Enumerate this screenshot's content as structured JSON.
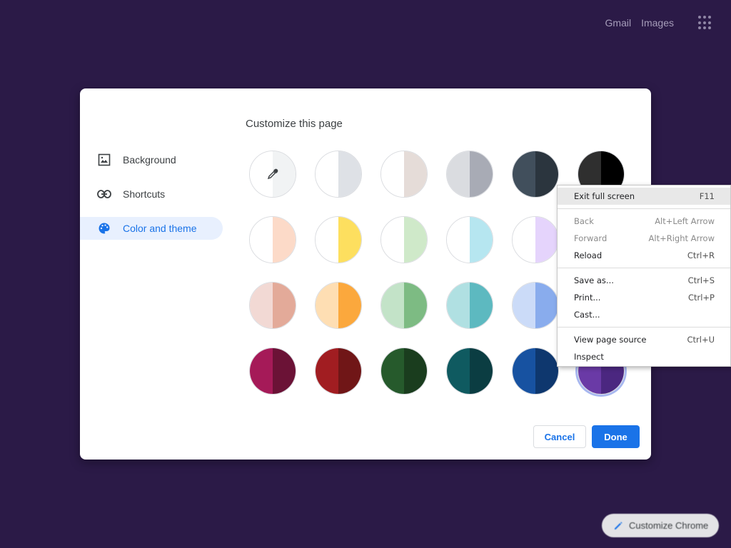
{
  "topbar": {
    "gmail": "Gmail",
    "images": "Images"
  },
  "dialog": {
    "title": "Customize this page",
    "nav": [
      {
        "label": "Background",
        "icon": "image-icon"
      },
      {
        "label": "Shortcuts",
        "icon": "link-icon"
      },
      {
        "label": "Color and theme",
        "icon": "palette-icon",
        "active": true
      }
    ],
    "swatches": [
      {
        "left": "#ffffff",
        "right": "#f1f3f4",
        "type": "custom"
      },
      {
        "left": "#ffffff",
        "right": "#dee1e6"
      },
      {
        "left": "#ffffff",
        "right": "#e5dcd8"
      },
      {
        "left": "#dadce0",
        "right": "#a8abb5"
      },
      {
        "left": "#414f5c",
        "right": "#2b353e"
      },
      {
        "left": "#2f2f2f",
        "right": "#000000"
      },
      {
        "left": "#ffffff",
        "right": "#fcdac8"
      },
      {
        "left": "#ffffff",
        "right": "#fddf5f"
      },
      {
        "left": "#ffffff",
        "right": "#cfe9c9"
      },
      {
        "left": "#ffffff",
        "right": "#b6e6f0"
      },
      {
        "left": "#ffffff",
        "right": "#e5d4fc"
      },
      {
        "left": "#ffffff",
        "right": "#f6d4de"
      },
      {
        "left": "#f2d9d4",
        "right": "#e3aa99"
      },
      {
        "left": "#fedeb3",
        "right": "#fba83d"
      },
      {
        "left": "#c3e3c8",
        "right": "#7dbb83"
      },
      {
        "left": "#b0e0e2",
        "right": "#5db9c0"
      },
      {
        "left": "#cbdbf8",
        "right": "#89aced"
      },
      {
        "left": "#dfcff5",
        "right": "#a88ae0"
      },
      {
        "left": "#a51a58",
        "right": "#6b1236"
      },
      {
        "left": "#a11d21",
        "right": "#701617"
      },
      {
        "left": "#265a2c",
        "right": "#1a3d1e"
      },
      {
        "left": "#0f5a60",
        "right": "#0b3d42"
      },
      {
        "left": "#1752a1",
        "right": "#0e376e"
      },
      {
        "left": "#6a3aa6",
        "right": "#4b2780",
        "selected": true
      }
    ],
    "cancel_label": "Cancel",
    "done_label": "Done"
  },
  "context_menu": {
    "exit_fullscreen": {
      "label": "Exit full screen",
      "shortcut": "F11"
    },
    "back": {
      "label": "Back",
      "shortcut": "Alt+Left Arrow"
    },
    "forward": {
      "label": "Forward",
      "shortcut": "Alt+Right Arrow"
    },
    "reload": {
      "label": "Reload",
      "shortcut": "Ctrl+R"
    },
    "save_as": {
      "label": "Save as...",
      "shortcut": "Ctrl+S"
    },
    "print": {
      "label": "Print...",
      "shortcut": "Ctrl+P"
    },
    "cast": {
      "label": "Cast..."
    },
    "view_source": {
      "label": "View page source",
      "shortcut": "Ctrl+U"
    },
    "inspect": {
      "label": "Inspect"
    }
  },
  "customize_chrome": {
    "label": "Customize Chrome"
  }
}
